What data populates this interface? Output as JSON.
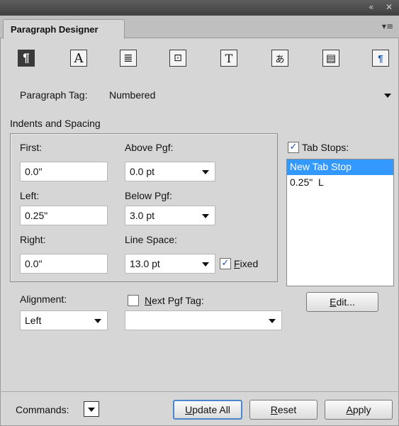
{
  "titlebar": {
    "collapse_icon": "double-chevron-left-icon",
    "close_icon": "close-icon"
  },
  "panel": {
    "tab_label": "Paragraph Designer",
    "menu_icon": "panel-menu-icon"
  },
  "toolbar": {
    "buttons": [
      {
        "name": "basic-properties-icon",
        "glyph": "¶"
      },
      {
        "name": "default-font-icon",
        "glyph": "A"
      },
      {
        "name": "pagination-icon",
        "glyph": "≣"
      },
      {
        "name": "numbering-icon",
        "glyph": "⊡"
      },
      {
        "name": "advanced-icon",
        "glyph": "T"
      },
      {
        "name": "asian-icon",
        "glyph": "あ"
      },
      {
        "name": "table-cell-icon",
        "glyph": "▤"
      },
      {
        "name": "direction-icon",
        "glyph": "¶"
      }
    ]
  },
  "tag": {
    "label": "Paragraph Tag:",
    "value": "Numbered"
  },
  "indents": {
    "section_title": "Indents and Spacing",
    "first_label": "First:",
    "first_value": "0.0\"",
    "left_label": "Left:",
    "left_value": "0.25\"",
    "right_label": "Right:",
    "right_value": "0.0\"",
    "above_label": "Above Pgf:",
    "above_value": "0.0 pt",
    "below_label": "Below Pgf:",
    "below_value": "3.0 pt",
    "line_label": "Line Space:",
    "line_value": "13.0 pt",
    "fixed_label": "Fixed",
    "fixed_checked": true
  },
  "tabstops": {
    "label": "Tab Stops:",
    "checked": true,
    "items": [
      "New Tab Stop",
      "0.25\"  L"
    ],
    "selected_index": 0,
    "edit_label": "Edit..."
  },
  "alignment": {
    "label": "Alignment:",
    "value": "Left"
  },
  "next_pgf": {
    "label": "Next Pgf Tag:",
    "checked": false,
    "value": ""
  },
  "bottom": {
    "commands_label": "Commands:",
    "update_all_label": "Update All",
    "reset_label": "Reset",
    "apply_label": "Apply"
  }
}
